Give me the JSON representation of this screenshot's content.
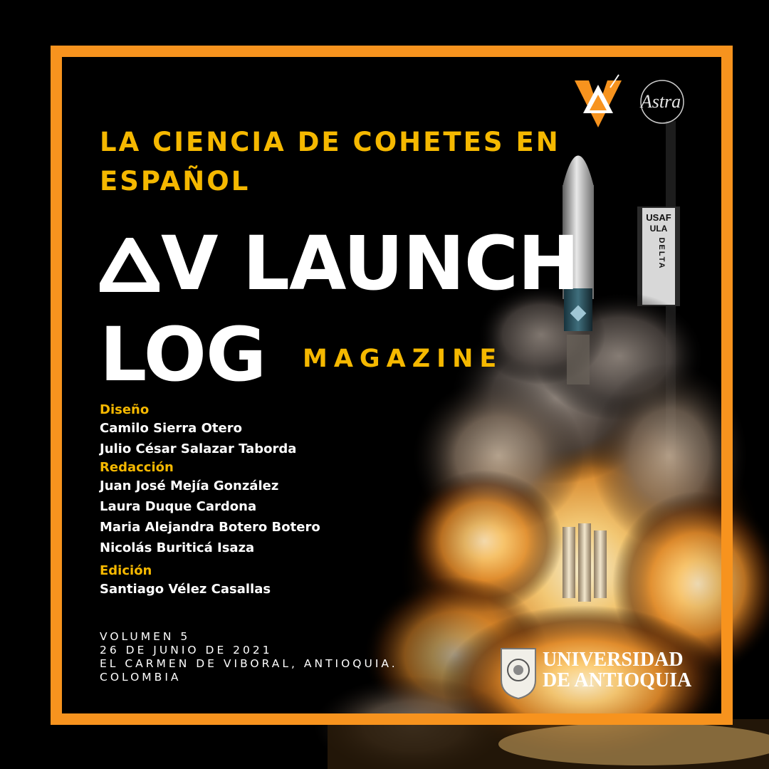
{
  "header": {
    "kicker": "LA CIENCIA DE COHETES EN ESPAÑOL"
  },
  "title": {
    "line1": "V LAUNCH",
    "line2": "LOG",
    "subtitle": "MAGAZINE"
  },
  "credits": [
    {
      "role": "Diseño",
      "names": [
        "Camilo Sierra Otero",
        "Julio César Salazar Taborda"
      ]
    },
    {
      "role": "Redacción",
      "names": [
        "Juan José Mejía González",
        "Laura Duque Cardona",
        "Maria Alejandra Botero Botero",
        "Nicolás Buriticá Isaza"
      ]
    },
    {
      "role": "Edición",
      "names": [
        "Santiago Vélez Casallas"
      ]
    }
  ],
  "publication": {
    "volume": "VOLUMEN 5",
    "date": "26 DE JUNIO DE 2021",
    "location_line1": "EL CARMEN DE VIBORAL, ANTIOQUIA.",
    "location_line2": "COLOMBIA"
  },
  "logos": {
    "astra_text": "Astra",
    "university_line1": "UNIVERSIDAD",
    "university_line2": "DE ANTIOQUIA",
    "rocket_label_usaf": "USAF",
    "rocket_label_ula": "ULA",
    "rocket_label_delta": "DELTA"
  },
  "colors": {
    "frame": "#F7931E",
    "accent_yellow": "#F5B800",
    "background": "#000000",
    "text": "#FFFFFF"
  }
}
